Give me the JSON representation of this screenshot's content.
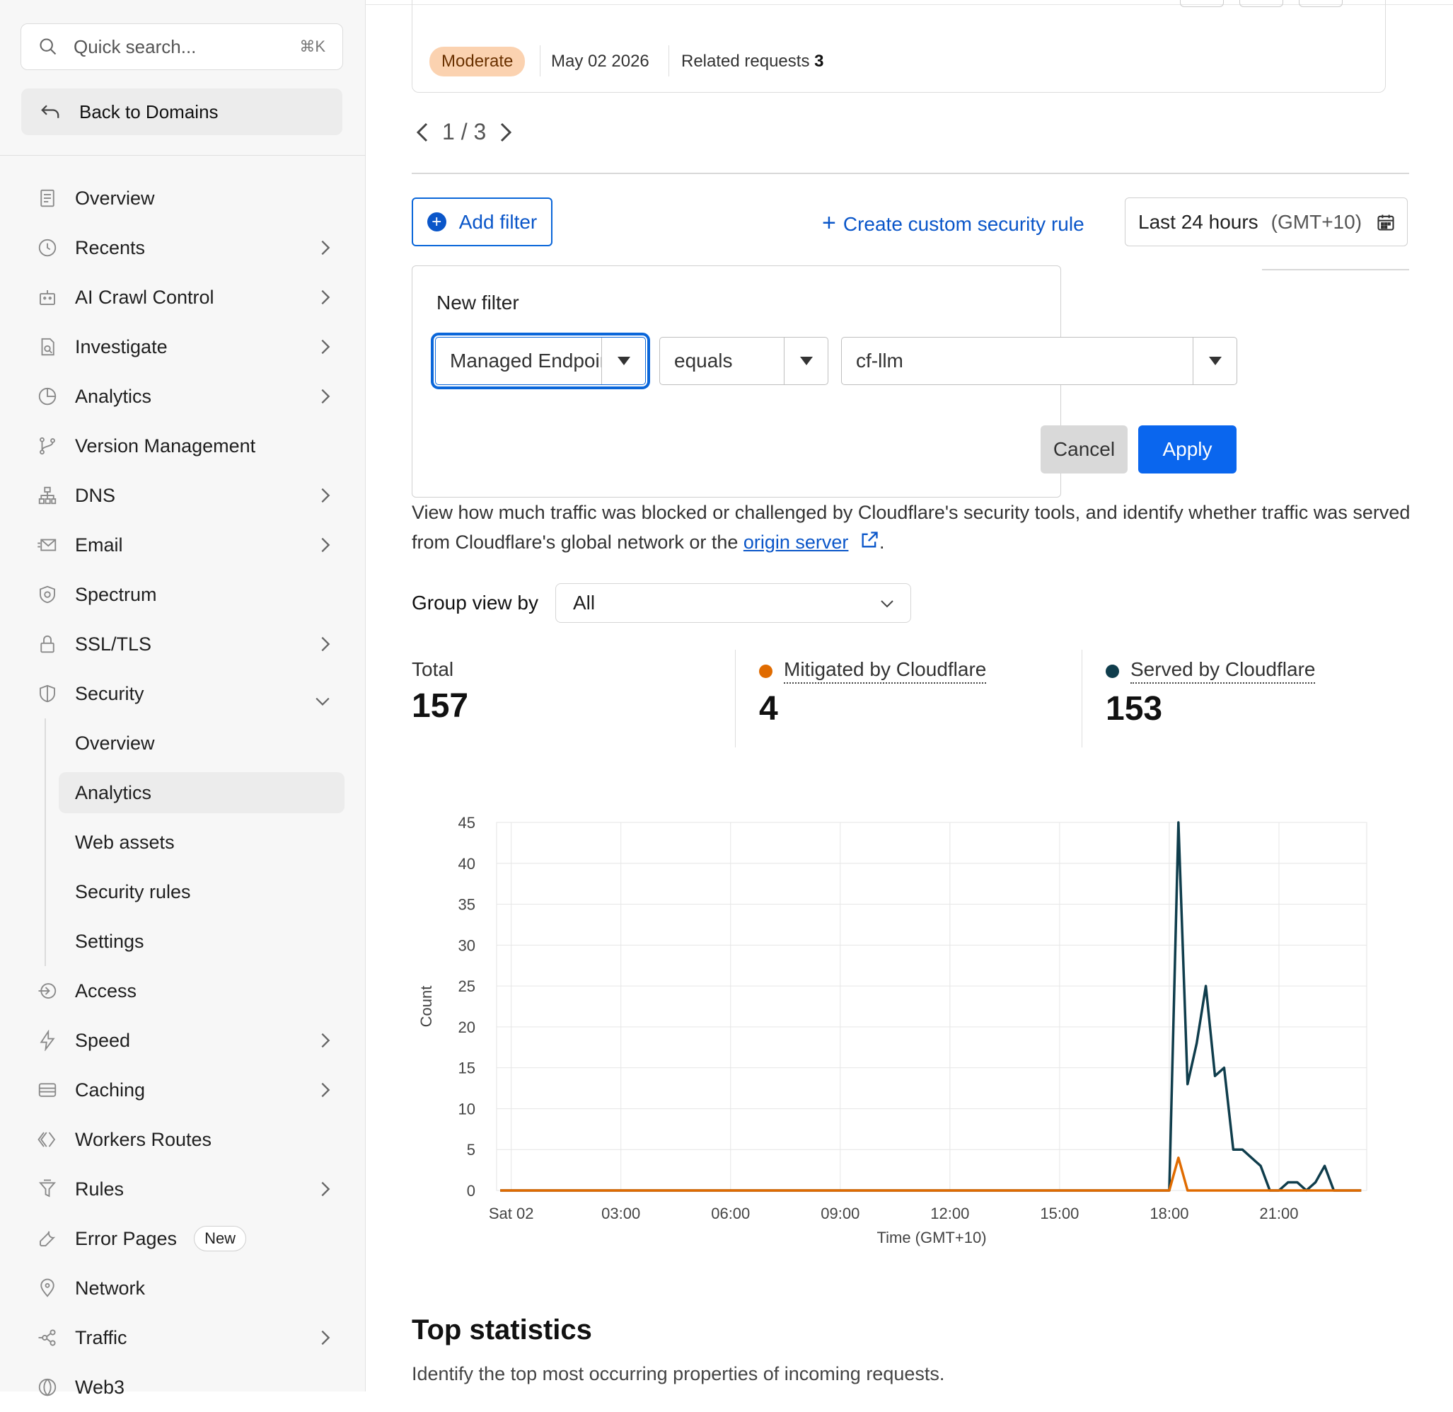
{
  "sidebar": {
    "search_placeholder": "Quick search...",
    "search_shortcut": "⌘K",
    "back_label": "Back to Domains",
    "items": [
      {
        "label": "Overview",
        "chevron": false,
        "icon": "document-icon"
      },
      {
        "label": "Recents",
        "chevron": true,
        "icon": "clock-icon"
      },
      {
        "label": "AI Crawl Control",
        "chevron": true,
        "icon": "robot-icon"
      },
      {
        "label": "Investigate",
        "chevron": true,
        "icon": "search-doc-icon"
      },
      {
        "label": "Analytics",
        "chevron": true,
        "icon": "pie-chart-icon"
      },
      {
        "label": "Version Management",
        "chevron": false,
        "icon": "branch-icon"
      },
      {
        "label": "DNS",
        "chevron": true,
        "icon": "sitemap-icon"
      },
      {
        "label": "Email",
        "chevron": true,
        "icon": "mail-icon"
      },
      {
        "label": "Spectrum",
        "chevron": false,
        "icon": "shield-gear-icon"
      },
      {
        "label": "SSL/TLS",
        "chevron": true,
        "icon": "lock-icon"
      },
      {
        "label": "Security",
        "chevron": "down",
        "icon": "shield-icon"
      }
    ],
    "security_sub": [
      {
        "label": "Overview",
        "active": false
      },
      {
        "label": "Analytics",
        "active": true
      },
      {
        "label": "Web assets",
        "active": false
      },
      {
        "label": "Security rules",
        "active": false
      },
      {
        "label": "Settings",
        "active": false
      }
    ],
    "items_after": [
      {
        "label": "Access",
        "chevron": false,
        "icon": "access-icon"
      },
      {
        "label": "Speed",
        "chevron": true,
        "icon": "bolt-icon"
      },
      {
        "label": "Caching",
        "chevron": true,
        "icon": "storage-icon"
      },
      {
        "label": "Workers Routes",
        "chevron": false,
        "icon": "workers-icon"
      },
      {
        "label": "Rules",
        "chevron": true,
        "icon": "funnel-icon"
      },
      {
        "label": "Error Pages",
        "chevron": false,
        "icon": "wrench-icon",
        "badge": "New"
      },
      {
        "label": "Network",
        "chevron": false,
        "icon": "pin-icon"
      },
      {
        "label": "Traffic",
        "chevron": true,
        "icon": "share-icon"
      },
      {
        "label": "Web3",
        "chevron": false,
        "icon": "web3-icon"
      }
    ]
  },
  "card": {
    "severity": "Moderate",
    "date": "May 02 2026",
    "related_label": "Related requests",
    "related_count": "3"
  },
  "pager": {
    "current": "1",
    "sep": "/",
    "total": "3"
  },
  "toolbar": {
    "add_filter": "Add filter",
    "custom_rule": "Create custom security rule",
    "range": "Last 24 hours",
    "tz": "(GMT+10)"
  },
  "filter": {
    "title": "New filter",
    "field": "Managed Endpoint",
    "operator": "equals",
    "value": "cf-llm",
    "cancel": "Cancel",
    "apply": "Apply"
  },
  "description": {
    "text": "View how much traffic was blocked or challenged by Cloudflare's security tools, and identify whether traffic was served from Cloudflare's global network or the ",
    "link": "origin server",
    "end": "."
  },
  "group": {
    "label": "Group view by",
    "value": "All"
  },
  "stats": {
    "total_label": "Total",
    "total": "157",
    "mitigated_label": "Mitigated by Cloudflare",
    "mitigated": "4",
    "served_label": "Served by Cloudflare",
    "served": "153",
    "mitigated_color": "#e06b00",
    "served_color": "#0f3d4c"
  },
  "chart_data": {
    "type": "line",
    "xlabel": "Time (GMT+10)",
    "ylabel": "Count",
    "ylim": [
      0,
      45
    ],
    "yticks": [
      0,
      5,
      10,
      15,
      20,
      25,
      30,
      35,
      40,
      45
    ],
    "xlim": [
      -0.4,
      23.4
    ],
    "xticks": [
      {
        "v": 0,
        "label": "Sat 02"
      },
      {
        "v": 3,
        "label": "03:00"
      },
      {
        "v": 6,
        "label": "06:00"
      },
      {
        "v": 9,
        "label": "09:00"
      },
      {
        "v": 12,
        "label": "12:00"
      },
      {
        "v": 15,
        "label": "15:00"
      },
      {
        "v": 18,
        "label": "18:00"
      },
      {
        "v": 21,
        "label": "21:00"
      }
    ],
    "grid": true,
    "series": [
      {
        "name": "Served by Cloudflare",
        "color": "#0f3d4c",
        "x": [
          -0.3,
          17.8,
          18.0,
          18.25,
          18.5,
          18.75,
          19.0,
          19.25,
          19.5,
          19.75,
          20.0,
          20.25,
          20.5,
          20.75,
          21.0,
          21.25,
          21.5,
          21.75,
          22.0,
          22.25,
          22.5,
          22.75,
          23.0,
          23.25
        ],
        "values": [
          0,
          0,
          0,
          45,
          13,
          18,
          25,
          14,
          15,
          5,
          5,
          4,
          3,
          0,
          0,
          1,
          1,
          0,
          1,
          3,
          0,
          0,
          0,
          0
        ]
      },
      {
        "name": "Mitigated by Cloudflare",
        "color": "#e06b00",
        "x": [
          -0.3,
          17.8,
          18.0,
          18.25,
          18.5,
          23.25
        ],
        "values": [
          0,
          0,
          0,
          4,
          0,
          0
        ]
      }
    ]
  },
  "top": {
    "title": "Top statistics",
    "desc": "Identify the top most occurring properties of incoming requests."
  }
}
